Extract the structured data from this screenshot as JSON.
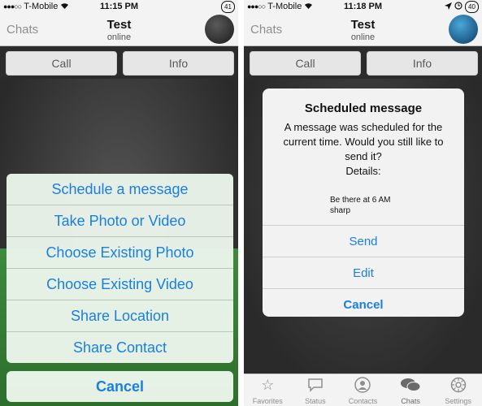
{
  "left": {
    "status": {
      "carrier": "T-Mobile",
      "time": "11:15 PM",
      "battery": "41"
    },
    "nav": {
      "back": "Chats",
      "title": "Test",
      "subtitle": "online"
    },
    "actions": {
      "call": "Call",
      "info": "Info"
    },
    "sheet": {
      "items": [
        "Schedule a message",
        "Take Photo or Video",
        "Choose Existing Photo",
        "Choose Existing Video",
        "Share Location",
        "Share Contact"
      ],
      "cancel": "Cancel"
    }
  },
  "right": {
    "status": {
      "carrier": "T-Mobile",
      "time": "11:18 PM",
      "battery": "40"
    },
    "nav": {
      "back": "Chats",
      "title": "Test",
      "subtitle": "online"
    },
    "actions": {
      "call": "Call",
      "info": "Info"
    },
    "alert": {
      "title": "Scheduled message",
      "message": "A message was scheduled for the current time. Would you still like to send it?",
      "details_label": "Details:",
      "details": "Be there at 6 AM\nsharp",
      "buttons": [
        "Send",
        "Edit",
        "Cancel"
      ]
    },
    "tabs": [
      {
        "label": "Favorites",
        "icon": "star-icon"
      },
      {
        "label": "Status",
        "icon": "speech-bubble-icon"
      },
      {
        "label": "Contacts",
        "icon": "person-icon"
      },
      {
        "label": "Chats",
        "icon": "chat-bubbles-icon"
      },
      {
        "label": "Settings",
        "icon": "gear-icon"
      }
    ]
  },
  "colors": {
    "accent": "#1a7fe0",
    "bar": "#f3f3f3",
    "green": "#3e8a3e"
  }
}
